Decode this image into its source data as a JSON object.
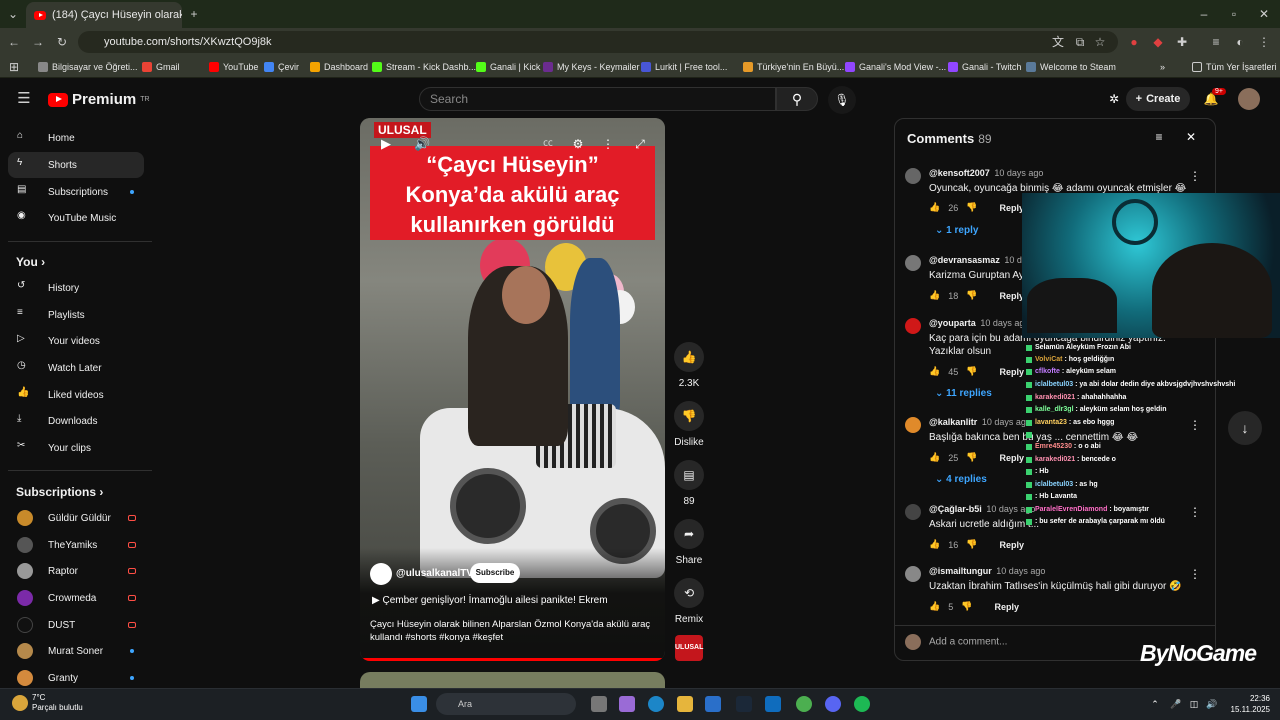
{
  "browser": {
    "tab_title": "(184) Çaycı Hüseyin olarak bilin",
    "url": "youtube.com/shorts/XKwztQO9j8k",
    "bookmarks": [
      "Bilgisayar ve Öğreti...",
      "Gmail",
      "YouTube",
      "Çevir",
      "Dashboard",
      "Stream - Kick Dashb...",
      "Ganali | Kick",
      "My Keys - Keymailer",
      "Lurkit | Free tool...",
      "Türkiye'nin En Büyü...",
      "Ganali's Mod View -...",
      "Ganali - Twitch",
      "Welcome to Steam"
    ],
    "all_bookmarks": "Tüm Yer İşaretleri"
  },
  "header": {
    "logo": "Premium",
    "logo_sup": "TR",
    "search_placeholder": "Search",
    "create_label": "Create",
    "notif_count": "9+"
  },
  "sidebar": {
    "main": [
      "Home",
      "Shorts",
      "Subscriptions",
      "YouTube Music"
    ],
    "you_title": "You",
    "you": [
      "History",
      "Playlists",
      "Your videos",
      "Watch Later",
      "Liked videos",
      "Downloads",
      "Your clips"
    ],
    "subs_title": "Subscriptions",
    "subs": [
      "Güldür Güldür",
      "TheYamiks",
      "Raptor",
      "Crowmeda",
      "DUST",
      "Murat Soner",
      "Granty"
    ]
  },
  "video": {
    "brand": "ULUSAL",
    "headline": "“Çaycı Hüseyin” Konya’da akülü araç kullanırken görüldü",
    "channel": "@ulusalkanalTV",
    "subscribe": "Subscribe",
    "line1": "▶ Çember genişliyor! İmamoğlu ailesi panikte! Ekrem",
    "description": "Çaycı Hüseyin olarak bilinen Alparslan Özmol Konya'da akülü araç kullandı #shorts #konya #keşfet"
  },
  "actions": {
    "likes": "2.3K",
    "dislike": "Dislike",
    "comments": "89",
    "share": "Share",
    "remix": "Remix"
  },
  "comments": {
    "title": "Comments",
    "count": "89",
    "add_placeholder": "Add a comment...",
    "reply_label": "Reply",
    "items": [
      {
        "user": "@kensoft2007",
        "time": "10 days ago",
        "text": "Oyuncak, oyuncağa binmiş 😂 adamı oyuncak etmişler 😂",
        "likes": "26",
        "replies": "1 reply"
      },
      {
        "user": "@devransasmaz",
        "time": "10 days ago",
        "text": "Karizma Guruptan Ayrı",
        "likes": "18",
        "replies": ""
      },
      {
        "user": "@youparta",
        "time": "10 days ago",
        "text": "Kaç para için bu adamı oyuncağa bindirdiniz yaptınız. Yazıklar olsun",
        "likes": "45",
        "replies": "11 replies"
      },
      {
        "user": "@kalkanlitr",
        "time": "10 days ago",
        "text": "Başlığa bakınca ben bu yaş ... cennettim 😂 😂",
        "likes": "25",
        "replies": "4 replies"
      },
      {
        "user": "@Çağlar-b5i",
        "time": "10 days ago",
        "text": "Askari ucretle aldığım t...",
        "likes": "16",
        "replies": ""
      },
      {
        "user": "@ismailtungur",
        "time": "10 days ago",
        "text": "Uzaktan İbrahim Tatlıses'in küçülmüş hali gibi duruyor 🤣",
        "likes": "5",
        "replies": ""
      }
    ]
  },
  "chat": [
    {
      "user": "",
      "msg": "Selamün Aleyküm Frozın Abi"
    },
    {
      "user": "VolviCat",
      "msg": "hoş geldiğğın"
    },
    {
      "user": "cflkofte",
      "msg": "aleyküm selam"
    },
    {
      "user": "iclalbetul03",
      "msg": "ya abi dolar dedin diye akbvsjgdvjhvshvshvshi"
    },
    {
      "user": "karakedi021",
      "msg": "ahahahhahha"
    },
    {
      "user": "kalle_dlr3gl",
      "msg": "aleyküm selam hoş geldin"
    },
    {
      "user": "lavanta23",
      "msg": "as ebo hggg"
    },
    {
      "user": "",
      "msg": ""
    },
    {
      "user": "Emre45230",
      "msg": "o o abi"
    },
    {
      "user": "karakedi021",
      "msg": "bencede o"
    },
    {
      "user": "",
      "msg": "Hb"
    },
    {
      "user": "iclalbetul03",
      "msg": "as hg"
    },
    {
      "user": "",
      "msg": "Hb Lavanta"
    },
    {
      "user": "ParalelEvrenDiamond",
      "msg": "boyamıştır"
    },
    {
      "user": "",
      "msg": "bu sefer de arabayla çarparak mı öldü"
    }
  ],
  "overlay_brand": "ByNoGame",
  "taskbar": {
    "temp": "7°C",
    "weather": "Parçalı bulutlu",
    "search": "Ara",
    "time": "22:36",
    "date": "15.11.2025"
  },
  "colors": {
    "accent_red": "#ff0000",
    "link_blue": "#3ea6ff",
    "bg": "#0f0f0f"
  }
}
